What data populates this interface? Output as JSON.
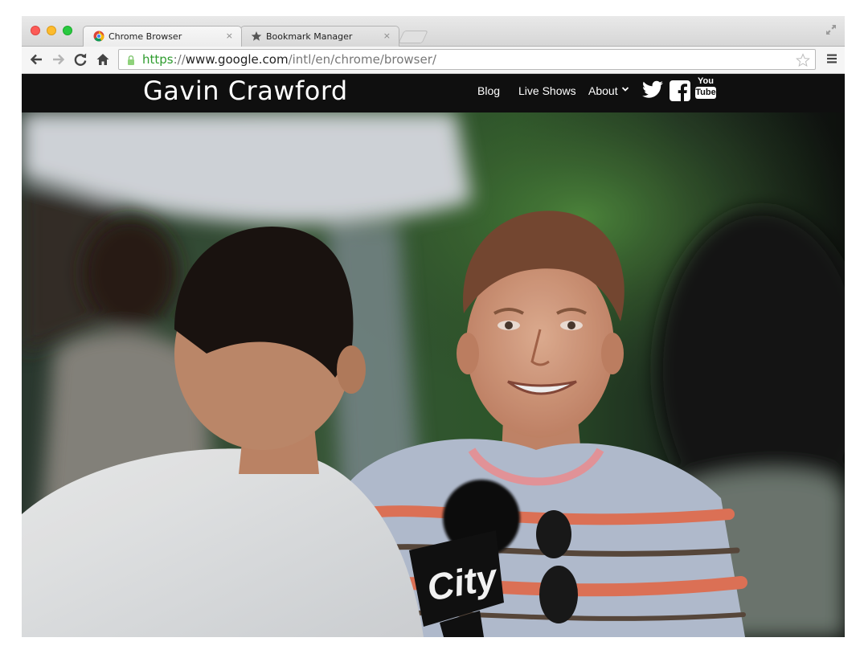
{
  "browser": {
    "tabs": [
      {
        "title": "Chrome Browser",
        "close": "×",
        "icon": "chrome-logo-icon",
        "active": true
      },
      {
        "title": "Bookmark Manager",
        "close": "×",
        "icon": "star-icon",
        "active": false
      }
    ],
    "url": {
      "scheme": "https",
      "separator": "://",
      "host": "www.google.com",
      "path": "/intl/en/chrome/browser/"
    }
  },
  "site": {
    "title": "Gavin Crawford",
    "nav": {
      "blog": "Blog",
      "live_shows": "Live Shows",
      "about": "About"
    },
    "social": [
      "twitter-icon",
      "facebook-icon",
      "youtube-icon"
    ],
    "youtube_top": "You",
    "youtube_bottom": "Tube"
  },
  "hero": {
    "mic_flag_text": "City"
  },
  "colors": {
    "nav_bg": "#0f0f0f",
    "url_scheme": "#2e9c2e"
  }
}
